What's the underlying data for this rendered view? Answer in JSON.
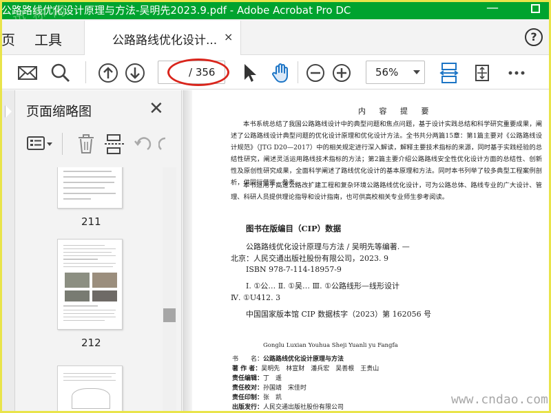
{
  "window": {
    "title": "公路路线优化设计原理与方法-吴明先2023.9.pdf - Adobe Acrobat Pro DC",
    "watermark": "迅 称 网",
    "minimize": "—"
  },
  "menu": {
    "home": "页",
    "tools": "工具"
  },
  "tab": {
    "label": "公路路线优化设计...",
    "close": "×"
  },
  "help": "?",
  "toolbar": {
    "page_total": "/ 356",
    "zoom": "56%"
  },
  "panel": {
    "title": "页面缩略图",
    "close": "✕",
    "thumbnails": [
      {
        "page": "211"
      },
      {
        "page": "212"
      }
    ]
  },
  "document": {
    "heading": "内 容 提 要",
    "paragraphs": [
      "本书系统总结了我国公路路线设计中的典型问题和焦点问题，基于设计实践总结和科学研究重要成果，阐述了公路路线设计典型问题的优化设计原理和优化设计方法。全书共分两篇15章：第1篇主要对《公路路线设计规范》（JTG D20—2017）中的相关规定进行深入解读，解释主要技术指标的来源，同时基于实践经验的总结性研究，阐述灵活运用路线技术指标的方法；第2篇主要介绍公路路线安全性优化设计方面的总结性、创新性及原创性研究成果，全面科学阐述了路线优化设计的基本原理和方法。同时本书列举了较多典型工程案例剖析，供同行借鉴、参考。",
      "本书适用于高速公路改扩建工程和复杂环境公路路线优化设计，可为公路总体、路线专业的广大设计、管理、科研人员提供理论指导和设计指南，也可供高校相关专业师生参考阅读。"
    ],
    "cip_title": "图书在版编目（CIP）数据",
    "cip_lines": [
      "公路路线优化设计原理与方法 / 吴明先等编著. —",
      "北京：人民交通出版社股份有限公司，2023. 9",
      "ISBN  978-7-114-18957-9",
      "Ⅰ. ①公…   Ⅱ. ①吴…   Ⅲ. ①公路线形—线形设计",
      "Ⅳ. ①U412. 3",
      "中国国家版本馆 CIP 数据核字（2023）第 162056 号"
    ],
    "pinyin": "Gonglu Luxian Youhua Sheji Yuanli yu Fangfa",
    "credits": [
      {
        "label": "书　　名：",
        "value": "公路路线优化设计原理与方法"
      },
      {
        "label": "著 作 者：",
        "value": "吴明先　林宣财　潘兵宏　吴善根　王贵山"
      },
      {
        "label": "责任编辑：",
        "value": "丁　遥"
      },
      {
        "label": "责任校对：",
        "value": "孙国靖　宋佳时"
      },
      {
        "label": "责任印制：",
        "value": "张　凯"
      },
      {
        "label": "出版发行：",
        "value": "人民交通出版社股份有限公司"
      }
    ]
  },
  "site_watermark": "www.cndao.com",
  "colors": {
    "titlebar": "#00a32f",
    "accent_blue": "#1b74c5",
    "annotation_red": "#d9251c"
  }
}
